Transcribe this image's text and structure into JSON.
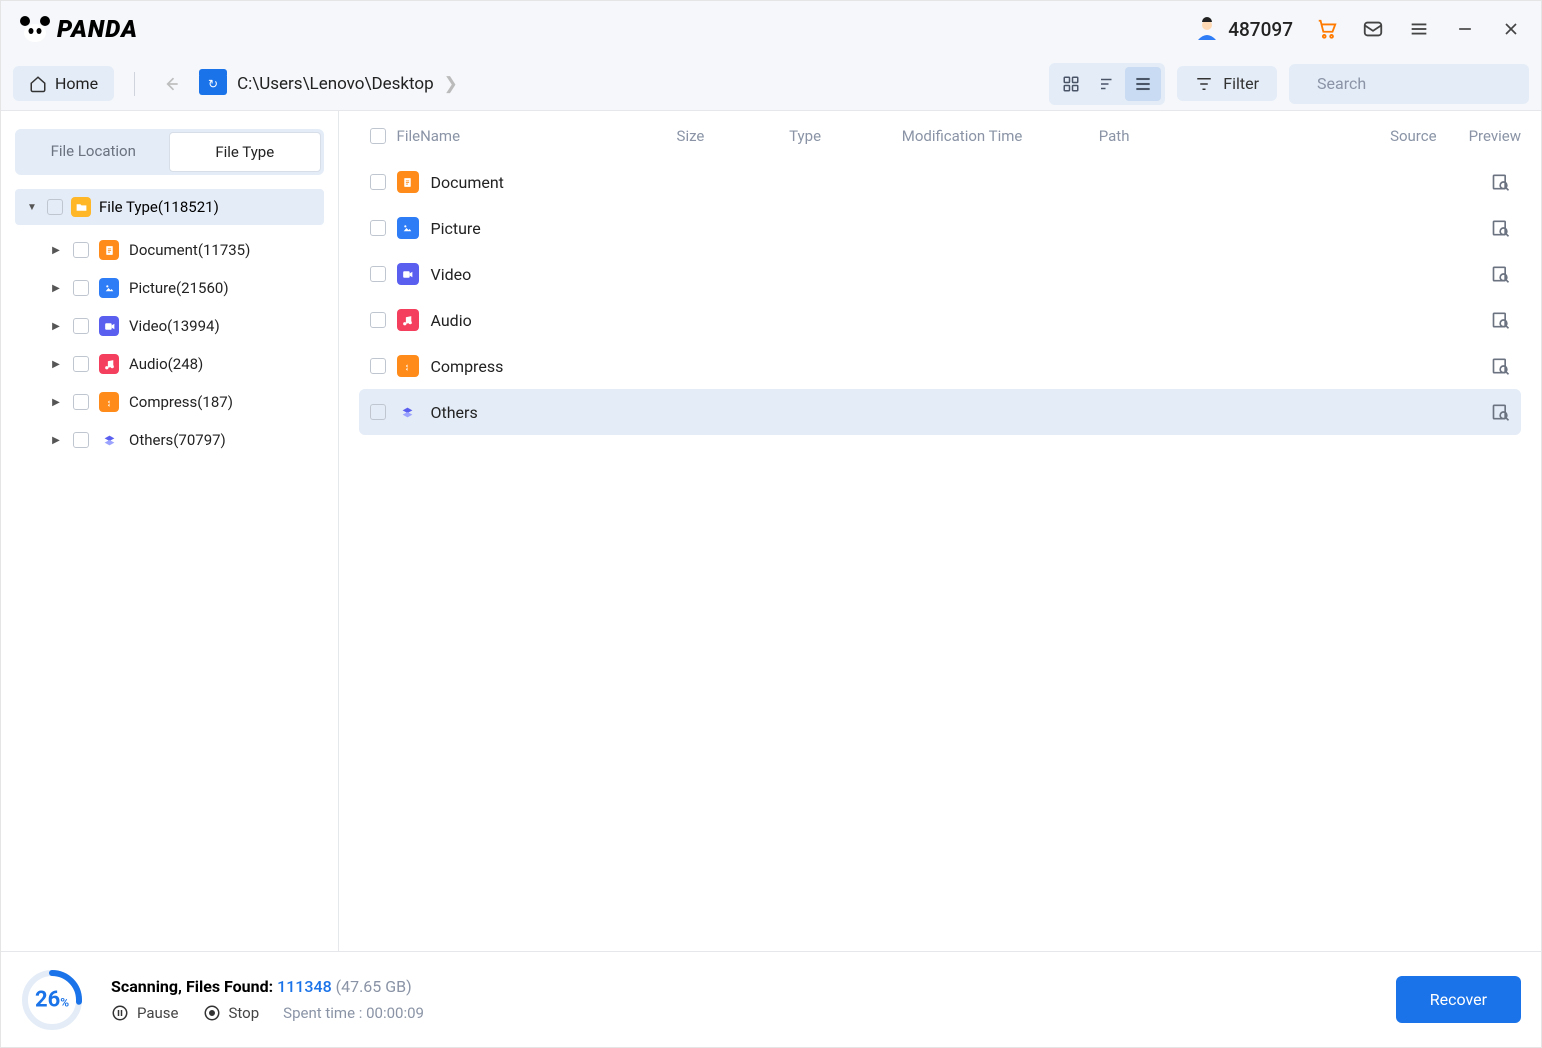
{
  "titlebar": {
    "app_name": "PANDA",
    "user_id": "487097"
  },
  "toolbar": {
    "home_label": "Home",
    "breadcrumb_path": "C:\\Users\\Lenovo\\Desktop",
    "filter_label": "Filter",
    "search_placeholder": "Search"
  },
  "sidebar": {
    "tabs": {
      "location": "File Location",
      "type": "File Type"
    },
    "root_label": "File Type(118521)",
    "items": [
      {
        "label": "Document(11735)",
        "kind": "doc"
      },
      {
        "label": "Picture(21560)",
        "kind": "pic"
      },
      {
        "label": "Video(13994)",
        "kind": "vid"
      },
      {
        "label": "Audio(248)",
        "kind": "aud"
      },
      {
        "label": "Compress(187)",
        "kind": "zip"
      },
      {
        "label": "Others(70797)",
        "kind": "oth"
      }
    ]
  },
  "table": {
    "headers": {
      "name": "FileName",
      "size": "Size",
      "type": "Type",
      "mtime": "Modification Time",
      "path": "Path",
      "source": "Source",
      "preview": "Preview"
    },
    "rows": [
      {
        "name": "Document",
        "kind": "doc"
      },
      {
        "name": "Picture",
        "kind": "pic"
      },
      {
        "name": "Video",
        "kind": "vid"
      },
      {
        "name": "Audio",
        "kind": "aud"
      },
      {
        "name": "Compress",
        "kind": "zip"
      },
      {
        "name": "Others",
        "kind": "oth",
        "hover": true
      }
    ]
  },
  "footer": {
    "progress_pct": "26",
    "scan_label": "Scanning, Files Found:",
    "files_found": "111348",
    "total_size": "(47.65 GB)",
    "pause_label": "Pause",
    "stop_label": "Stop",
    "spent_label": "Spent time : 00:00:09",
    "recover_label": "Recover"
  }
}
